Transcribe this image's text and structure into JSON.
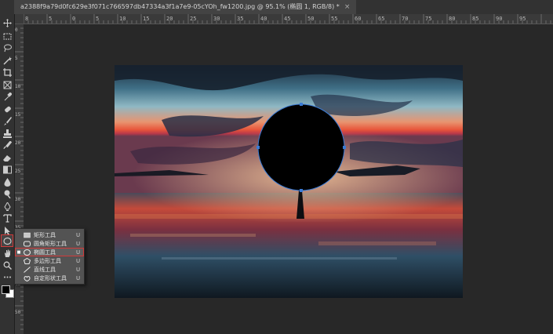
{
  "document": {
    "tab_title": "a2388f9a79d0fc629e3f071c766597db47334a3f1a7e9-05cYOh_fw1200.jpg  @  95.1% (椭圆 1, RGB/8) *",
    "close_glyph": "×"
  },
  "rulers": {
    "horizontal": [
      "8",
      "5",
      "0",
      "5",
      "10",
      "15",
      "20",
      "25",
      "30",
      "35",
      "40",
      "45",
      "50",
      "55",
      "60",
      "65",
      "70",
      "75",
      "80",
      "85",
      "90",
      "95"
    ],
    "vertical": [
      "0",
      "5",
      "10",
      "15",
      "20",
      "25",
      "30",
      "35",
      "40",
      "45",
      "50"
    ]
  },
  "tools": [
    {
      "name": "move-tool-icon"
    },
    {
      "name": "marquee-tool-icon"
    },
    {
      "name": "lasso-tool-icon"
    },
    {
      "name": "magic-wand-tool-icon"
    },
    {
      "name": "crop-tool-icon"
    },
    {
      "name": "frame-tool-icon"
    },
    {
      "name": "eyedropper-tool-icon"
    },
    {
      "name": "healing-brush-tool-icon"
    },
    {
      "name": "brush-tool-icon"
    },
    {
      "name": "clone-stamp-tool-icon"
    },
    {
      "name": "history-brush-tool-icon"
    },
    {
      "name": "eraser-tool-icon"
    },
    {
      "name": "gradient-tool-icon"
    },
    {
      "name": "blur-tool-icon"
    },
    {
      "name": "dodge-tool-icon"
    },
    {
      "name": "pen-tool-icon"
    },
    {
      "name": "type-tool-icon"
    },
    {
      "name": "path-selection-tool-icon"
    },
    {
      "name": "ellipse-tool-icon"
    },
    {
      "name": "hand-tool-icon"
    },
    {
      "name": "zoom-tool-icon"
    },
    {
      "name": "more-tools-icon"
    }
  ],
  "shape_flyout": {
    "items": [
      {
        "label": "矩形工具",
        "key": "U",
        "icon": "rectangle-tool-icon",
        "active": false
      },
      {
        "label": "圆角矩形工具",
        "key": "U",
        "icon": "rounded-rectangle-tool-icon",
        "active": false
      },
      {
        "label": "椭圆工具",
        "key": "U",
        "icon": "ellipse-tool-icon",
        "active": true
      },
      {
        "label": "多边形工具",
        "key": "U",
        "icon": "polygon-tool-icon",
        "active": false
      },
      {
        "label": "直线工具",
        "key": "U",
        "icon": "line-tool-icon",
        "active": false
      },
      {
        "label": "自定形状工具",
        "key": "U",
        "icon": "custom-shape-tool-icon",
        "active": false
      }
    ]
  },
  "colors": {
    "foreground": "#000000",
    "background": "#ffffff",
    "highlight": "#d23a3a",
    "anchor": "#3a7bd5"
  }
}
